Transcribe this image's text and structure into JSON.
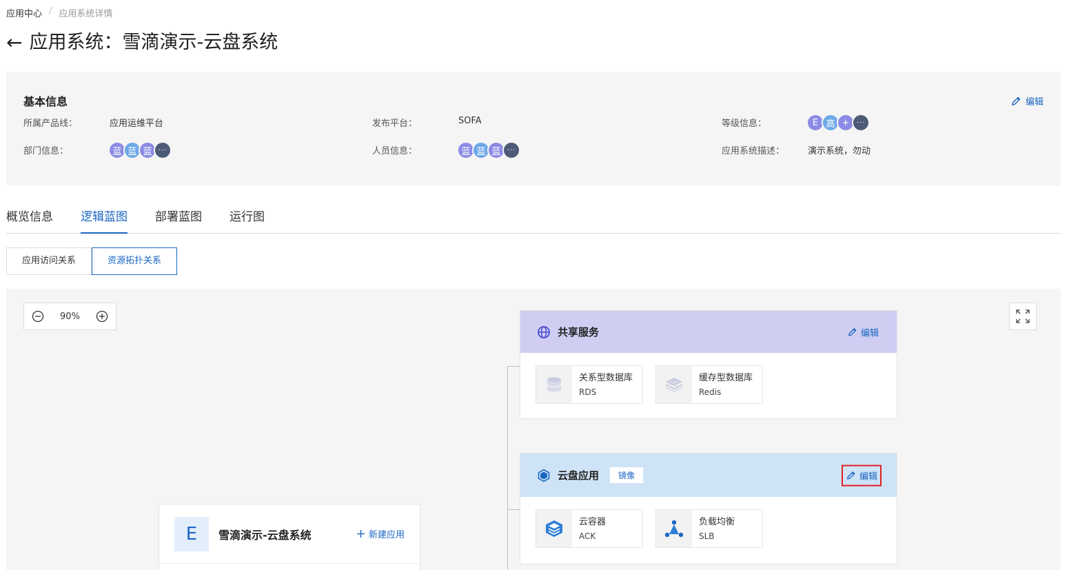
{
  "breadcrumb": {
    "root": "应用中心",
    "separator": "/",
    "current": "应用系统详情"
  },
  "header": {
    "back_icon": "arrow-left-icon",
    "title": "应用系统：雪滴演示-云盘系统"
  },
  "basic_info": {
    "heading": "基本信息",
    "edit_label": "编辑",
    "product_line": {
      "label": "所属产品线：",
      "value": "应用运维平台"
    },
    "publish_platform": {
      "label": "发布平台：",
      "value": "SOFA"
    },
    "level_info": {
      "label": "等级信息：",
      "avatars": [
        "E",
        "高",
        "+",
        "···"
      ]
    },
    "department": {
      "label": "部门信息：",
      "avatars": [
        "蓝",
        "蓝",
        "蓝",
        "···"
      ]
    },
    "personnel": {
      "label": "人员信息：",
      "avatars": [
        "蓝",
        "蓝",
        "蓝",
        "···"
      ]
    },
    "description": {
      "label": "应用系统描述：",
      "value": "演示系统，勿动"
    }
  },
  "tabs": [
    "概览信息",
    "逻辑蓝图",
    "部署蓝图",
    "运行图"
  ],
  "active_tab": "逻辑蓝图",
  "subtabs": [
    "应用访问关系",
    "资源拓扑关系"
  ],
  "active_subtab": "资源拓扑关系",
  "canvas": {
    "zoom": "90%",
    "groups": [
      {
        "title": "共享服务",
        "icon": "globe-icon",
        "edit_label": "编辑",
        "resources": [
          {
            "name": "关系型数据库",
            "type": "RDS",
            "icon": "database-icon"
          },
          {
            "name": "缓存型数据库",
            "type": "Redis",
            "icon": "cache-stack-icon"
          }
        ]
      },
      {
        "title": "云盘应用",
        "icon": "hexagon-icon",
        "badge": "镜像",
        "edit_label": "编辑",
        "resources": [
          {
            "name": "云容器",
            "type": "ACK",
            "icon": "container-icon"
          },
          {
            "name": "负载均衡",
            "type": "SLB",
            "icon": "load-balancer-icon"
          }
        ]
      }
    ],
    "app": {
      "letter": "E",
      "name": "雪滴演示-云盘系统",
      "new_app_label": "新建应用"
    }
  },
  "colors": {
    "accent": "#1a66c2",
    "highlight_border": "#e02020",
    "shared_header": "#cfcef2",
    "app_header": "#cfe3f7"
  }
}
